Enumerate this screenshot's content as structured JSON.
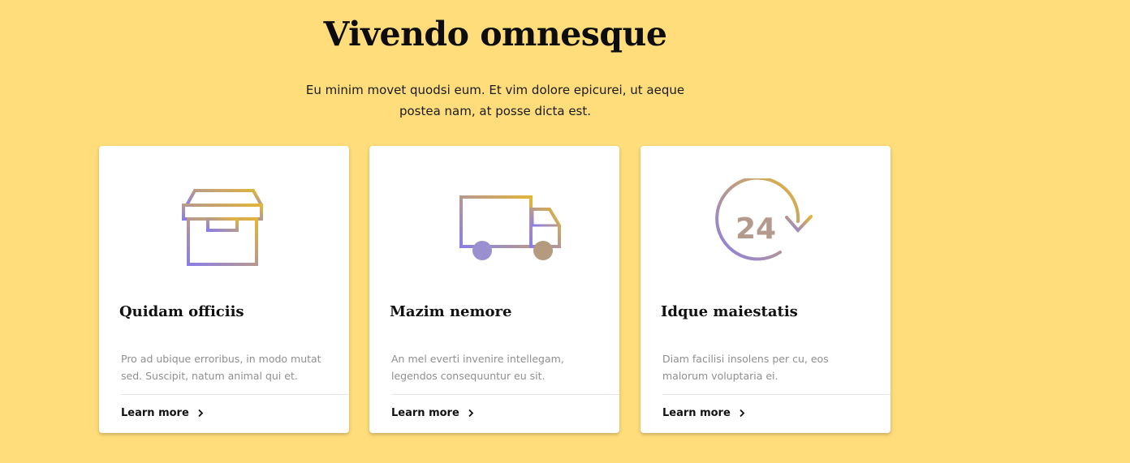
{
  "hero": {
    "title": "Vivendo omnesque",
    "subtitle_line1": "Eu minim movet quodsi eum. Et vim dolore epicurei, ut aeque",
    "subtitle_line2": "postea nam, at posse dicta est."
  },
  "cards": [
    {
      "icon": "archive-box-icon",
      "title": "Quidam officiis",
      "text_line1": "Pro ad ubique erroribus, in modo mutat",
      "text_line2": "sed. Suscipit, natum animal qui et.",
      "link_label": "Learn more"
    },
    {
      "icon": "delivery-truck-icon",
      "title": "Mazim nemore",
      "text_line1": "An mel everti invenire intellegam,",
      "text_line2": "legendos consequuntur eu sit.",
      "link_label": "Learn more"
    },
    {
      "icon": "clock-24-hours-icon",
      "icon_text": "24",
      "title": "Idque maiestatis",
      "text_line1": "Diam facilisi insolens per cu, eos",
      "text_line2": "malorum voluptaria ei.",
      "link_label": "Learn more"
    }
  ],
  "colors": {
    "background": "#ffdd7a",
    "icon_gradient_start": "#8a7ee6",
    "icon_gradient_end": "#e2b53a"
  }
}
